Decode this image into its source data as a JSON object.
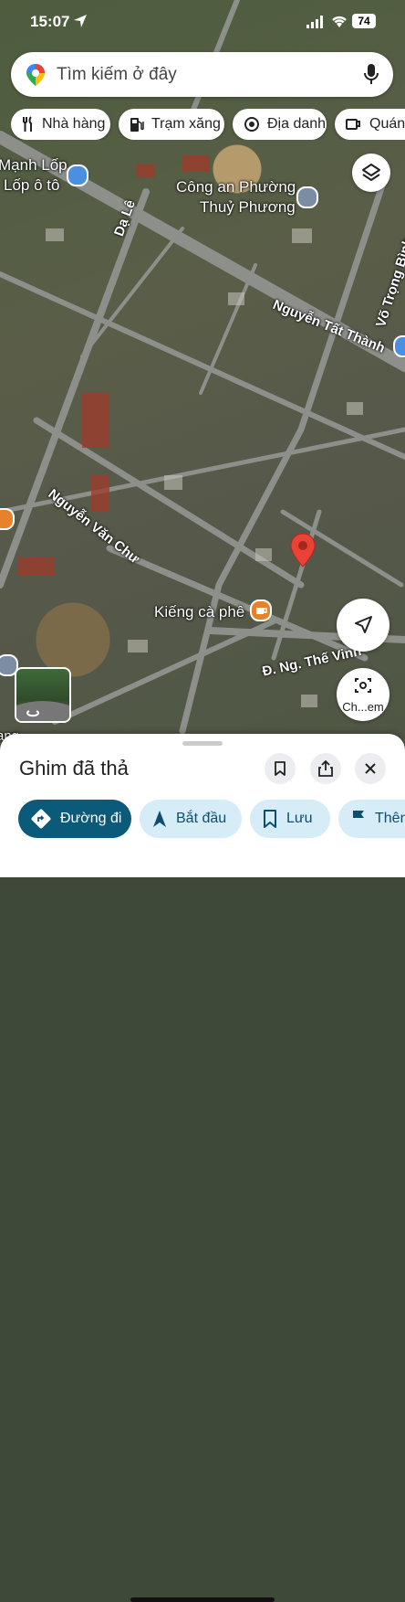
{
  "status": {
    "time": "15:07",
    "battery": "74"
  },
  "search": {
    "placeholder": "Tìm kiếm ở đây"
  },
  "chips": [
    {
      "label": "Nhà hàng",
      "icon": "fork-knife-icon"
    },
    {
      "label": "Trạm xăng",
      "icon": "gas-pump-icon"
    },
    {
      "label": "Địa danh",
      "icon": "camera-icon"
    },
    {
      "label": "Quán c",
      "icon": "coffee-cup-icon"
    }
  ],
  "map": {
    "places": {
      "tire_shop_1": "Mạnh Lốp",
      "tire_shop_2": "Lốp ô tô",
      "police_1": "Công an Phường",
      "police_2": "Thuỷ Phương",
      "cafe": "Kiếng cà phê",
      "left_bottom": "ang"
    },
    "streets": {
      "da_le": "Dạ Lê",
      "nguyen_tat_thanh": "Nguyễn Tất Thành",
      "vo_trong_binh": "Võ Trọng Bình",
      "nguyen_van_chu": "Nguyễn Văn Chư",
      "ng_the_vinh": "Đ. Ng. Thế Vinh"
    },
    "pin_color": "#ea4335"
  },
  "lens_button": {
    "label": "Ch...em"
  },
  "sheet": {
    "title": "Ghim đã thả",
    "actions": [
      {
        "label": "Đường đi",
        "icon": "directions-icon"
      },
      {
        "label": "Bắt đầu",
        "icon": "navigation-arrow-icon"
      },
      {
        "label": "Lưu",
        "icon": "bookmark-icon"
      },
      {
        "label": "Thên",
        "icon": "flag-icon"
      }
    ]
  },
  "colors": {
    "primary": "#0b5a7a",
    "secondary": "#d6ecf6"
  }
}
